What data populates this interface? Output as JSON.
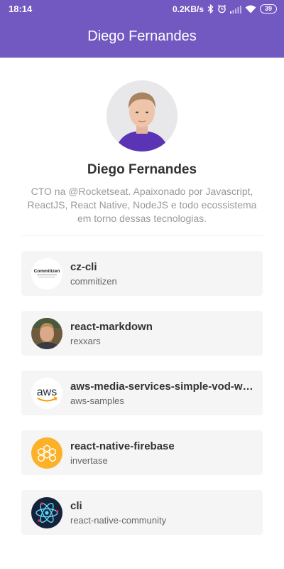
{
  "status_bar": {
    "time": "18:14",
    "network_speed": "0.2KB/s",
    "battery_level": "39",
    "icons": [
      "bluetooth-icon",
      "alarm-icon",
      "signal-icon",
      "wifi-icon",
      "battery-icon"
    ]
  },
  "header": {
    "title": "Diego Fernandes",
    "background_color": "#7159c1"
  },
  "profile": {
    "name": "Diego Fernandes",
    "bio": "CTO na @Rocketseat. Apaixonado por Javascript, ReactJS, React Native, NodeJS e todo ecossistema em torno dessas tecnologias."
  },
  "repositories": [
    {
      "name": "cz-cli",
      "owner": "commitizen",
      "logo_text": "Commitizen",
      "logo": "commitizen-logo"
    },
    {
      "name": "react-markdown",
      "owner": "rexxars",
      "logo": "rexxars-avatar"
    },
    {
      "name": "aws-media-services-simple-vod-workflow",
      "owner": "aws-samples",
      "logo_text": "aws",
      "logo": "aws-logo"
    },
    {
      "name": "react-native-firebase",
      "owner": "invertase",
      "logo": "firebase-hexagon-logo"
    },
    {
      "name": "cli",
      "owner": "react-native-community",
      "logo": "react-atom-logo"
    }
  ]
}
